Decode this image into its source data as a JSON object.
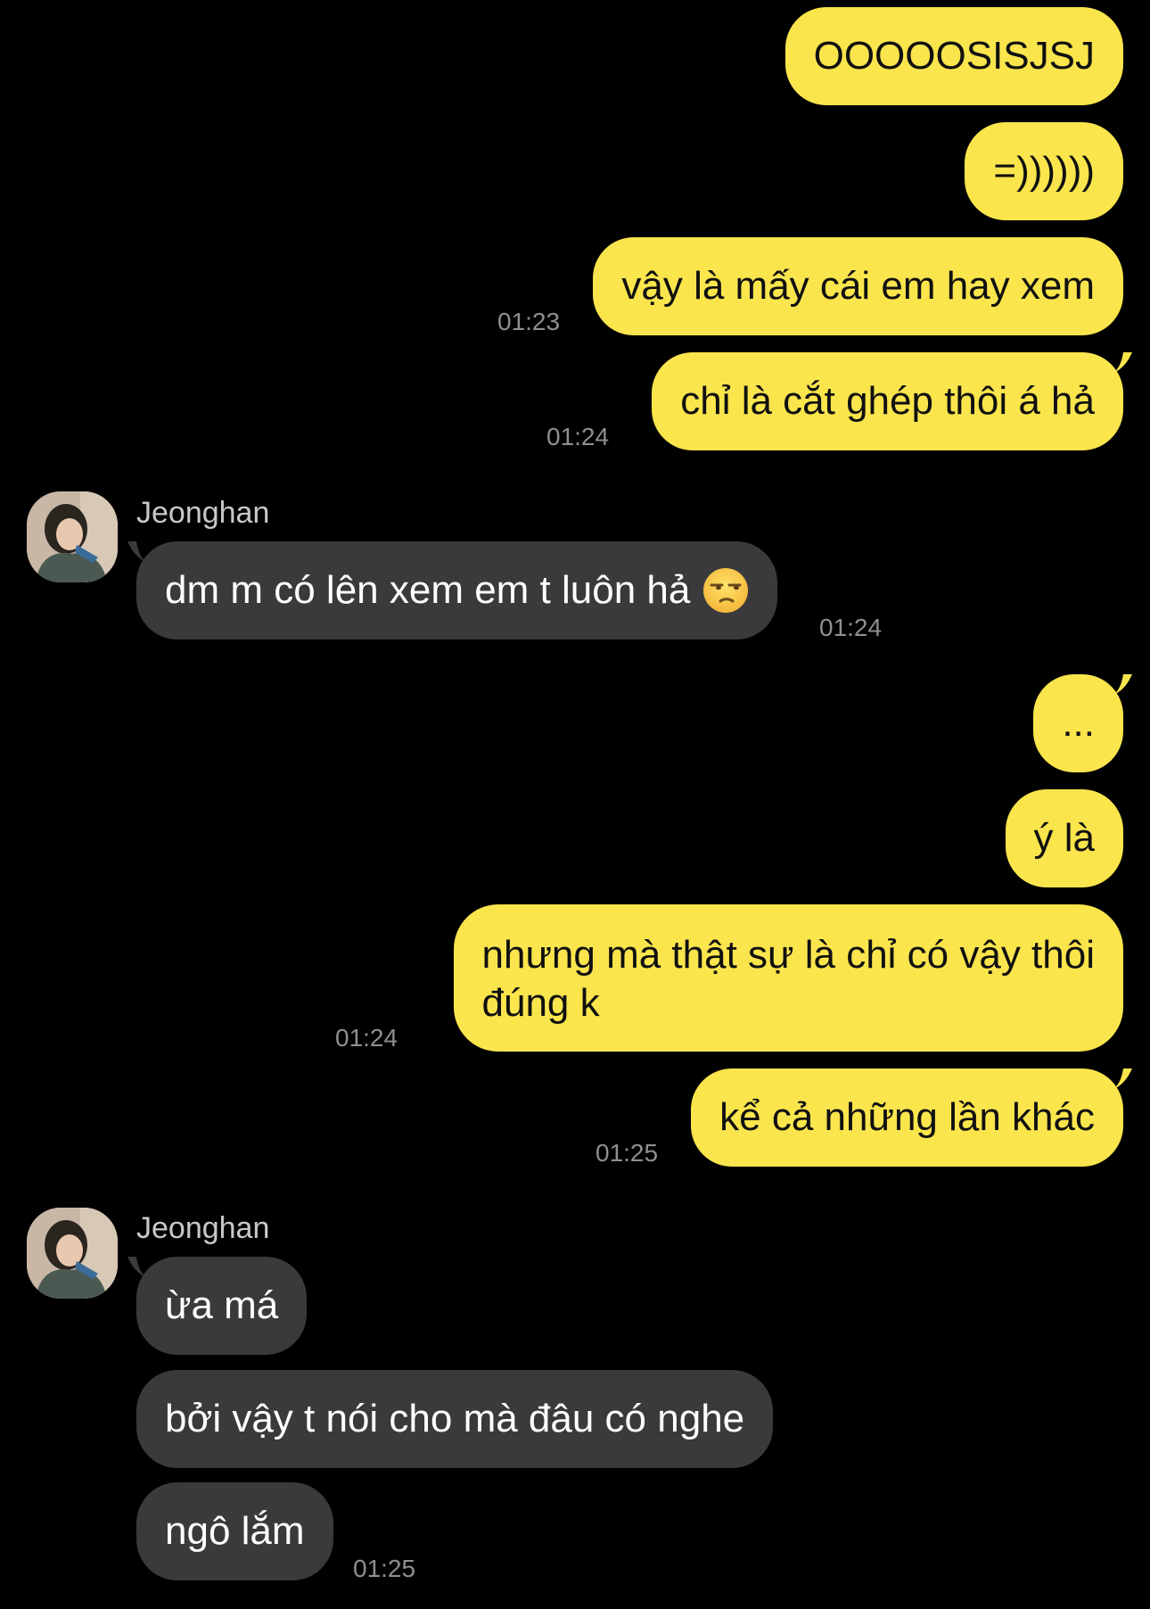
{
  "messages": [
    {
      "side": "sent",
      "text": "OOOOOSISJSJ"
    },
    {
      "side": "sent",
      "text": "=))))))"
    },
    {
      "side": "sent",
      "text": "vậy là mấy cái em hay xem",
      "time": "01:23"
    },
    {
      "side": "sent",
      "text": "chỉ là cắt ghép thôi á hả",
      "time": "01:24"
    },
    {
      "side": "recv",
      "sender": "Jeonghan",
      "text": "dm m có lên xem em t luôn hả",
      "emoji": "unamused-face",
      "time": "01:24"
    },
    {
      "side": "sent",
      "text": "..."
    },
    {
      "side": "sent",
      "text": "ý là"
    },
    {
      "side": "sent",
      "lines": [
        "nhưng mà thật sự là chỉ có vậy thôi",
        "đúng k"
      ],
      "time": "01:24"
    },
    {
      "side": "sent",
      "text": "kể cả những lần khác",
      "time": "01:25"
    },
    {
      "side": "recv",
      "sender": "Jeonghan",
      "text": "ừa má"
    },
    {
      "side": "recv",
      "text": "bởi vậy t nói cho mà đâu có nghe"
    },
    {
      "side": "recv",
      "text": "ngô lắm",
      "time": "01:25"
    }
  ],
  "colors": {
    "background": "#000000",
    "sent_bubble": "#fbe54d",
    "received_bubble": "#3a3a3c",
    "timestamp": "#8e8e93"
  }
}
